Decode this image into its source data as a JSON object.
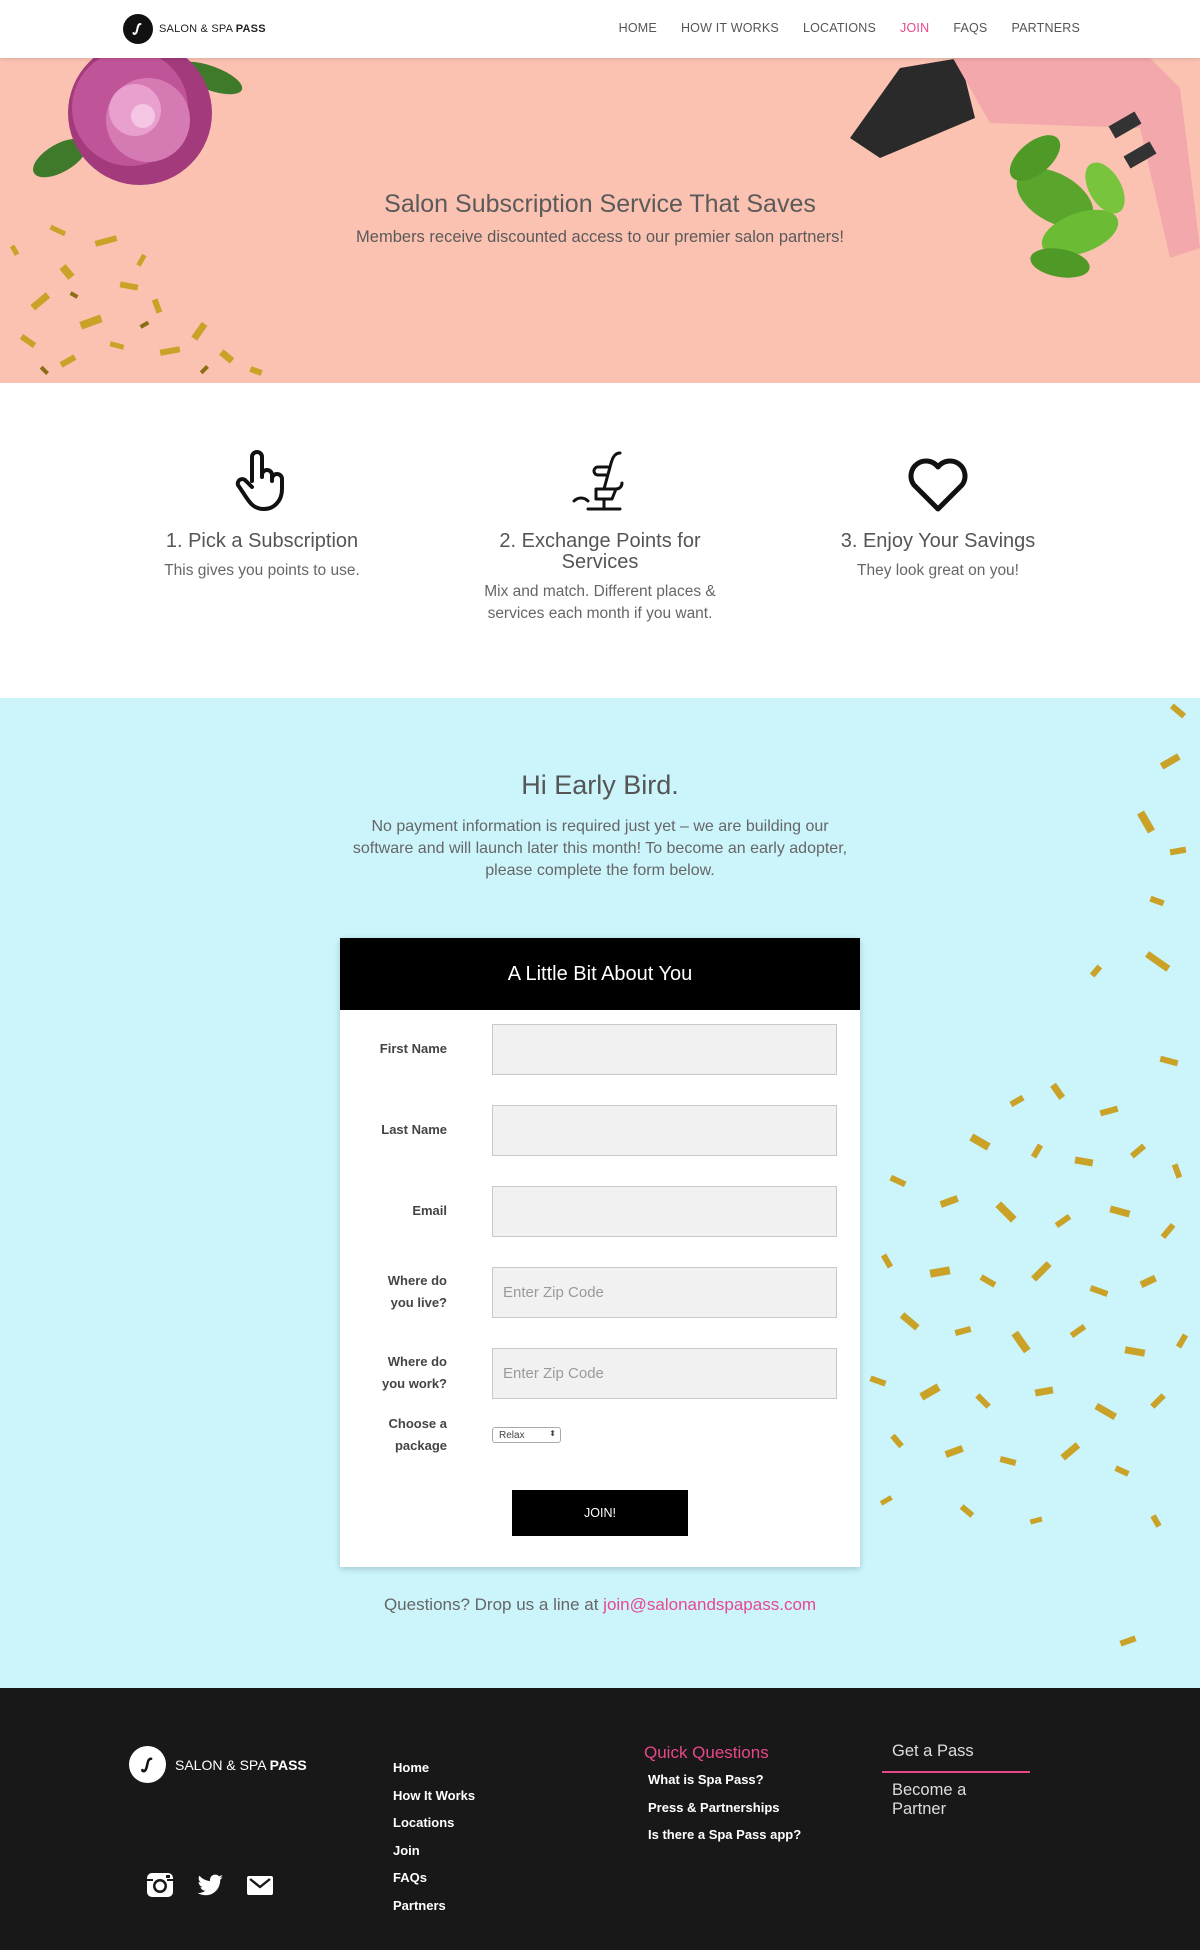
{
  "nav": {
    "logo_prefix": "SALON & SPA",
    "logo_bold": "PASS",
    "links": [
      {
        "label": "HOME",
        "active": false
      },
      {
        "label": "HOW IT WORKS",
        "active": false
      },
      {
        "label": "LOCATIONS",
        "active": false
      },
      {
        "label": "JOIN",
        "active": true
      },
      {
        "label": "FAQS",
        "active": false
      },
      {
        "label": "PARTNERS",
        "active": false
      }
    ]
  },
  "hero": {
    "title": "Salon Subscription Service That Saves",
    "subtitle": "Members receive discounted access to our premier salon partners!"
  },
  "steps": [
    {
      "icon": "pointing-hand-icon",
      "title": "1. Pick a Subscription",
      "text": "This gives you points to use."
    },
    {
      "icon": "salon-chair-icon",
      "title": "2. Exchange Points for Services",
      "text": "Mix and match. Different places & services each month if you want."
    },
    {
      "icon": "heart-icon",
      "title": "3. Enjoy Your Savings",
      "text": "They look great on you!"
    }
  ],
  "signup": {
    "title": "Hi Early Bird.",
    "text": "No payment information is required just yet – we are building our software and will launch later this month! To become an early adopter, please complete the form below.",
    "form_title": "A Little Bit About You",
    "fields": {
      "first_name_label": "First Name",
      "last_name_label": "Last Name",
      "email_label": "Email",
      "live_label_1": "Where do",
      "live_label_2": "you live?",
      "live_placeholder": "Enter Zip Code",
      "work_label_1": "Where do",
      "work_label_2": "you work?",
      "work_placeholder": "Enter Zip Code",
      "package_label_1": "Choose a",
      "package_label_2": "package",
      "package_value": "Relax"
    },
    "join_label": "JOIN!",
    "questions_prefix": "Questions? Drop us a line at ",
    "email_link": "join@salonandspapass.com"
  },
  "footer": {
    "logo_prefix": "SALON & SPA",
    "logo_bold": "PASS",
    "links": [
      "Home",
      "How It Works",
      "Locations",
      "Join",
      "FAQs",
      "Partners"
    ],
    "quick_title": "Quick Questions",
    "quick_links": [
      "What is Spa Pass?",
      "Press & Partnerships",
      "Is there a Spa Pass app?"
    ],
    "cta_get": "Get a Pass",
    "cta_partner": "Become a Partner",
    "social": [
      "instagram-icon",
      "twitter-icon",
      "mail-icon"
    ]
  },
  "colors": {
    "accent": "#e8478b",
    "hero_bg": "#fbc2b2",
    "signup_bg": "#cbf4fb",
    "footer_bg": "#181818"
  }
}
